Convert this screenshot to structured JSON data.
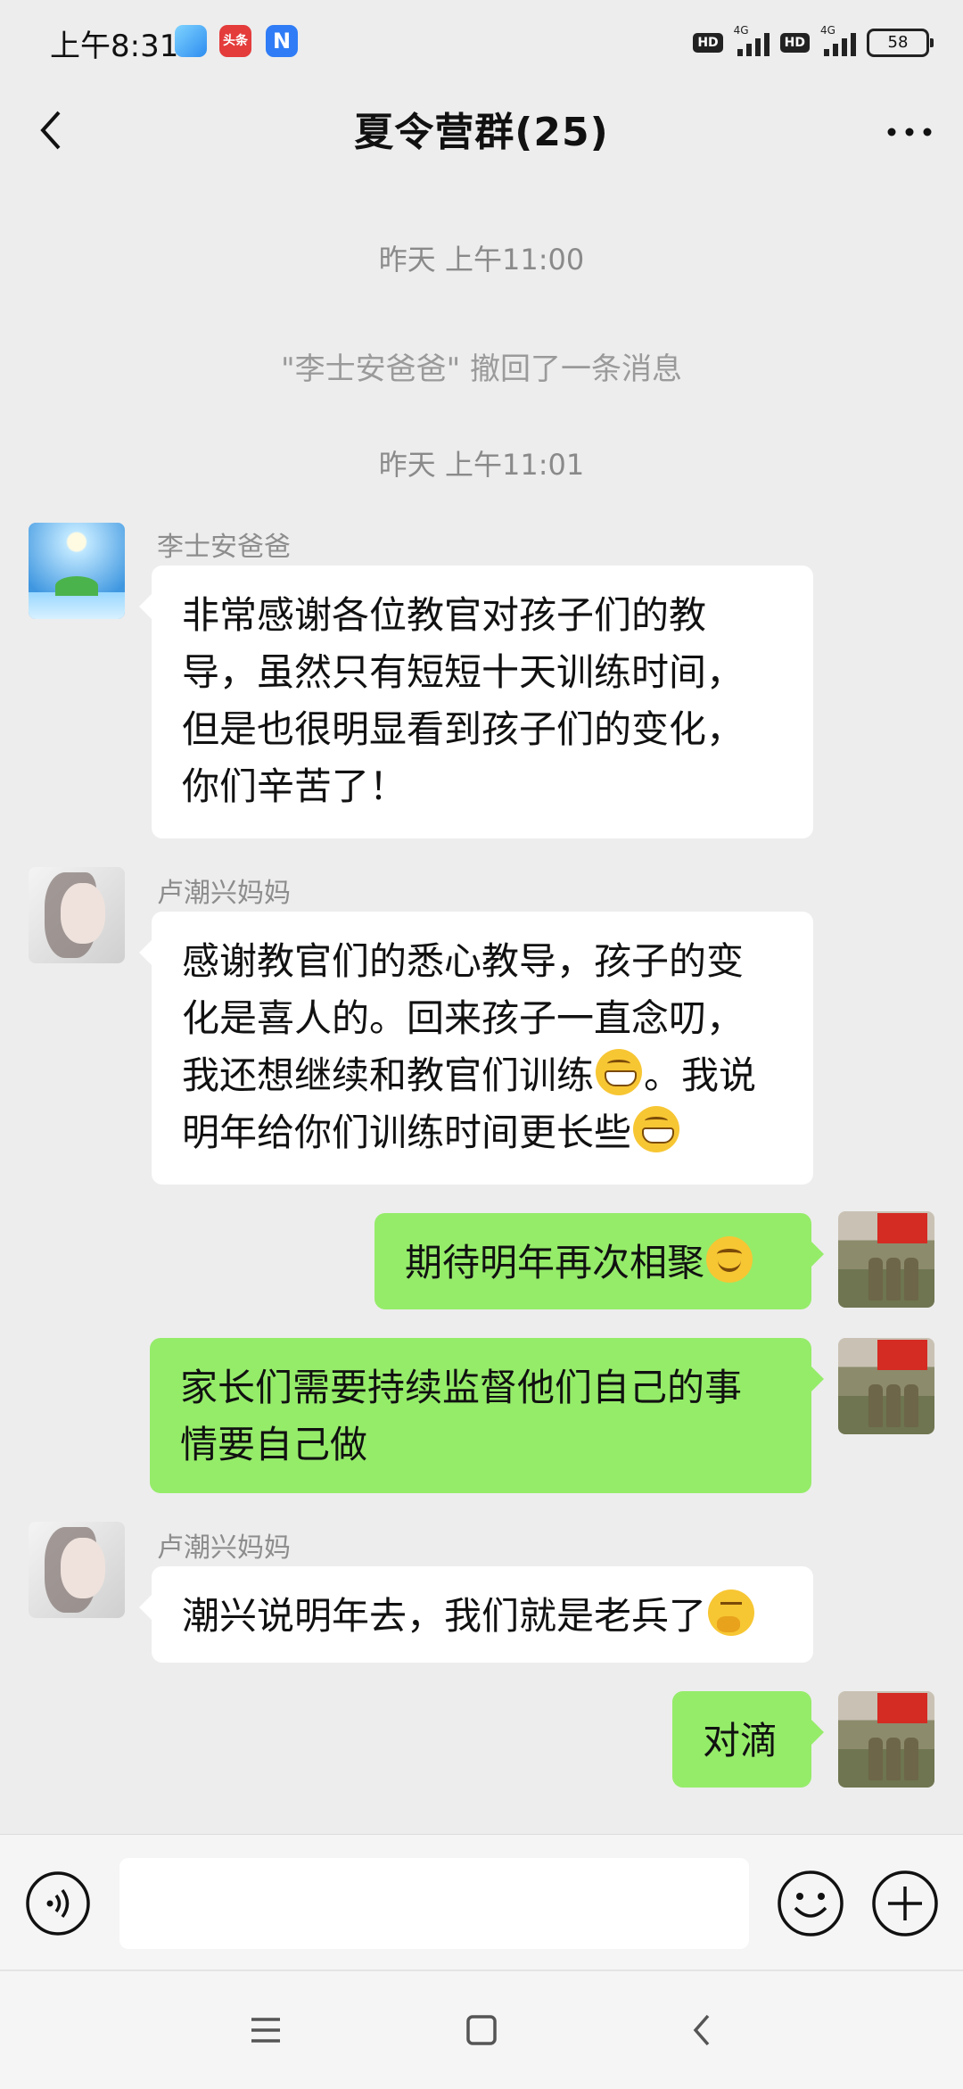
{
  "status_bar": {
    "time": "上午8:31",
    "app_badge_2": "头条",
    "app_badge_3": "N",
    "hd_1": "HD",
    "hd_2": "HD",
    "net_1": "4G",
    "net_2": "4G",
    "battery": "58"
  },
  "header": {
    "title": "夏令营群(25)"
  },
  "timeline": {
    "ts1": "昨天 上午11:00",
    "system_msg": "\"李士安爸爸\" 撤回了一条消息",
    "ts2": "昨天 上午11:01"
  },
  "messages": [
    {
      "sender": "李士安爸爸",
      "lines": [
        "非常感谢各位教官对孩子们的教",
        "导，虽然只有短短十天训练时间，",
        "但是也很明显看到孩子们的变化，",
        "你们辛苦了！"
      ]
    },
    {
      "sender": "卢潮兴妈妈",
      "line1": "感谢教官们的悉心教导，孩子的变",
      "line2": "化是喜人的。回来孩子一直念叨，",
      "line3a": "我还想继续和教官们训练",
      "line3b": "。我说",
      "line4": "明年给你们训练时间更长些"
    },
    {
      "text": "期待明年再次相聚"
    },
    {
      "lines": [
        "家长们需要持续监督他们自己的事",
        "情要自己做"
      ]
    },
    {
      "sender": "卢潮兴妈妈",
      "text": "潮兴说明年去，我们就是老兵了"
    },
    {
      "text": "对滴"
    }
  ]
}
